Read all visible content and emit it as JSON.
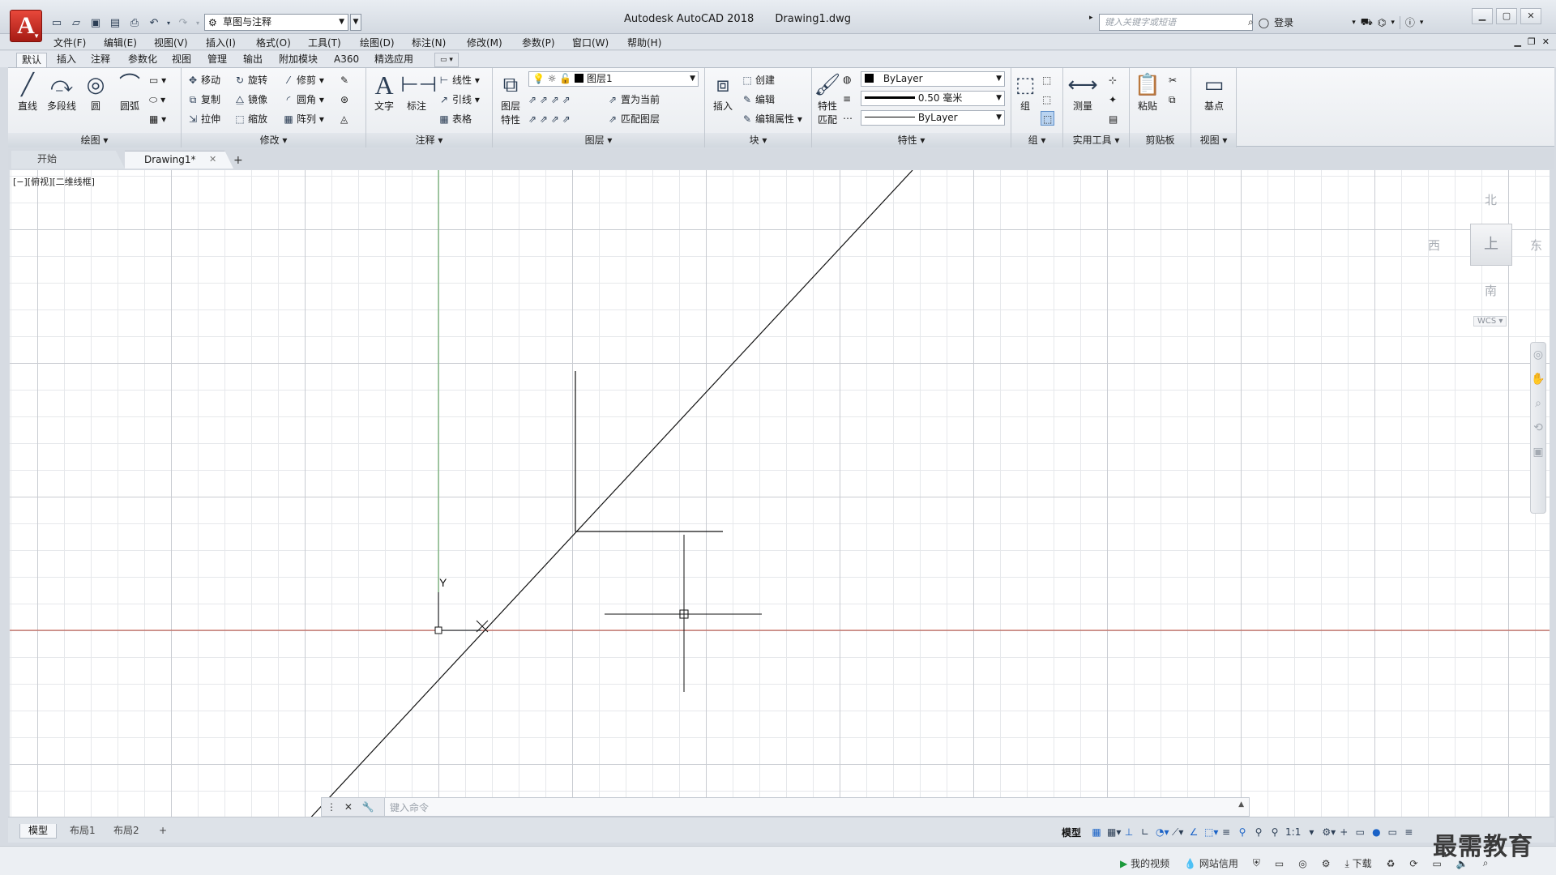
{
  "app": {
    "logo_letter": "A",
    "title": "Autodesk AutoCAD 2018",
    "document": "Drawing1.dwg"
  },
  "qat": {
    "workspace": "草图与注释"
  },
  "search": {
    "placeholder": "键入关键字或短语"
  },
  "account": {
    "login": "登录"
  },
  "menu": [
    "文件(F)",
    "编辑(E)",
    "视图(V)",
    "插入(I)",
    "格式(O)",
    "工具(T)",
    "绘图(D)",
    "标注(N)",
    "修改(M)",
    "参数(P)",
    "窗口(W)",
    "帮助(H)"
  ],
  "ribbon_tabs": [
    "默认",
    "插入",
    "注释",
    "参数化",
    "视图",
    "管理",
    "输出",
    "附加模块",
    "A360",
    "精选应用"
  ],
  "panels": {
    "draw": {
      "title": "绘图",
      "line": "直线",
      "polyline": "多段线",
      "circle": "圆",
      "arc": "圆弧"
    },
    "modify": {
      "title": "修改",
      "move": "移动",
      "rotate": "旋转",
      "trim": "修剪",
      "copy": "复制",
      "mirror": "镜像",
      "fillet": "圆角",
      "stretch": "拉伸",
      "scale": "缩放",
      "array": "阵列"
    },
    "annotation": {
      "title": "注释",
      "text": "文字",
      "dimension": "标注",
      "linear": "线性",
      "leader": "引线",
      "table": "表格"
    },
    "layers": {
      "title": "图层",
      "properties_l1": "图层",
      "properties_l2": "特性",
      "current_layer": "图层1",
      "set_current": "置为当前",
      "match_layer": "匹配图层"
    },
    "block": {
      "title": "块",
      "insert": "插入",
      "create": "创建",
      "edit": "编辑",
      "edit_attr": "编辑属性"
    },
    "properties": {
      "title": "特性",
      "match_l1": "特性",
      "match_l2": "匹配",
      "color": "ByLayer",
      "lineweight": "0.50 毫米",
      "linetype": "ByLayer"
    },
    "groups": {
      "title": "组",
      "group": "组"
    },
    "utilities": {
      "title": "实用工具",
      "measure": "测量"
    },
    "clipboard": {
      "title": "剪贴板",
      "paste": "粘贴"
    },
    "view": {
      "title": "视图",
      "base": "基点"
    }
  },
  "doc_tabs": {
    "start": "开始",
    "drawing": "Drawing1*"
  },
  "viewport": {
    "label": "[−][俯视][二维线框]"
  },
  "viewcube": {
    "north": "北",
    "south": "南",
    "east": "东",
    "west": "西",
    "top": "上",
    "wcs": "WCS"
  },
  "ucs": {
    "y_label": "Y"
  },
  "command": {
    "placeholder": "键入命令"
  },
  "layout_tabs": [
    "模型",
    "布局1",
    "布局2"
  ],
  "status": {
    "model": "模型",
    "scale": "1:1"
  },
  "taskbar": {
    "video": "我的视频",
    "credit": "网站信用",
    "download": "下载"
  },
  "watermark": "最需教育",
  "colors": {
    "accent_red": "#c8291f",
    "x_axis": "#c04a3a",
    "y_axis": "#5aa65a"
  }
}
